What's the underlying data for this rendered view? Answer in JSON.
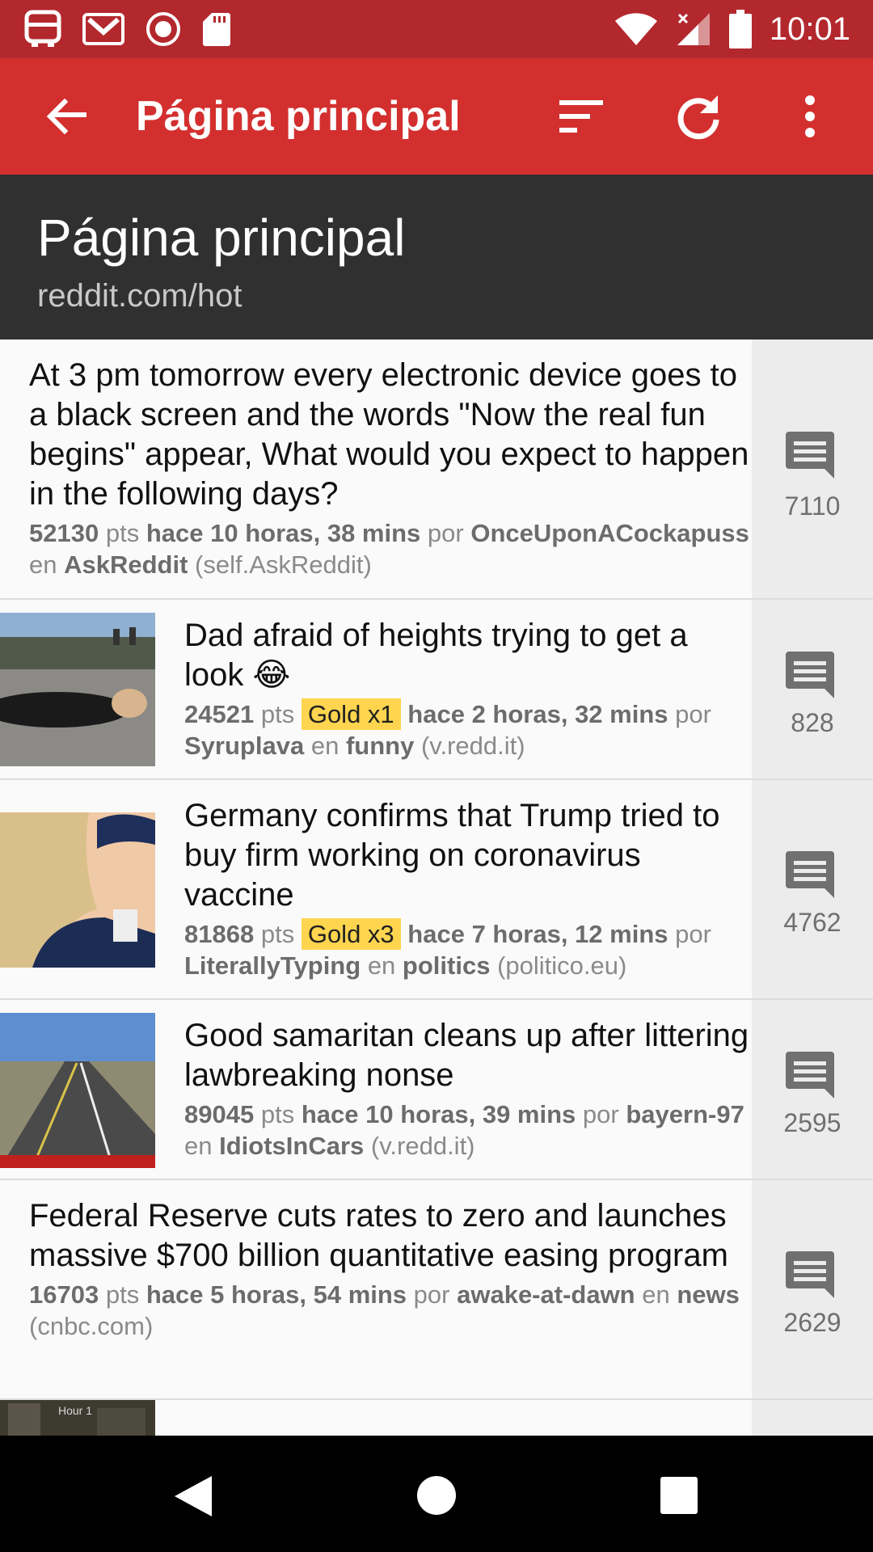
{
  "status_bar": {
    "time": "10:01",
    "icons": [
      "bus-icon",
      "gmail-icon",
      "record-icon",
      "sdcard-icon",
      "wifi-icon",
      "signal-icon",
      "battery-icon"
    ]
  },
  "app_bar": {
    "title": "Página principal",
    "icons": [
      "back-arrow-icon",
      "sort-icon",
      "refresh-icon",
      "more-vert-icon"
    ]
  },
  "header": {
    "title": "Página principal",
    "subtitle": "reddit.com/hot"
  },
  "posts": [
    {
      "title": "At 3 pm tomorrow every electronic device goes to a black screen and the words \"Now the real fun begins\" appear, What would you expect to happen in the following days?",
      "points": "52130",
      "pts_label": "pts",
      "gold": "",
      "time": "hace 10 horas, 38 mins",
      "por": "por",
      "author": "OnceUponACockapuss",
      "en": "en",
      "subreddit": "AskReddit",
      "domain": "(self.AskReddit)",
      "comments": "7110"
    },
    {
      "title": "Dad afraid of heights trying to get a look 😂",
      "points": "24521",
      "pts_label": "pts",
      "gold": "Gold x1",
      "time": "hace 2 horas, 32 mins",
      "por": "por",
      "author": "Syruplava",
      "en": "en",
      "subreddit": "funny",
      "domain": "(v.redd.it)",
      "comments": "828"
    },
    {
      "title": "Germany confirms that Trump tried to buy firm working on coronavirus vaccine",
      "points": "81868",
      "pts_label": "pts",
      "gold": "Gold x3",
      "time": "hace 7 horas, 12 mins",
      "por": "por",
      "author": "LiterallyTyping",
      "en": "en",
      "subreddit": "politics",
      "domain": "(politico.eu)",
      "comments": "4762"
    },
    {
      "title": "Good samaritan cleans up after littering lawbreaking nonse",
      "points": "89045",
      "pts_label": "pts",
      "gold": "",
      "time": "hace 10 horas, 39 mins",
      "por": "por",
      "author": "bayern-97",
      "en": "en",
      "subreddit": "IdiotsInCars",
      "domain": "(v.redd.it)",
      "comments": "2595"
    },
    {
      "title": "Federal Reserve cuts rates to zero and launches massive $700 billion quantitative easing program",
      "points": "16703",
      "pts_label": "pts",
      "gold": "",
      "time": "hace 5 horas, 54 mins",
      "por": "por",
      "author": "awake-at-dawn",
      "en": "en",
      "subreddit": "news",
      "domain": "(cnbc.com)",
      "comments": "2629"
    }
  ],
  "partial_thumb_label": "Hour 1",
  "nav_bar": {
    "icons": [
      "back-triangle-icon",
      "home-circle-icon",
      "recents-square-icon"
    ]
  }
}
